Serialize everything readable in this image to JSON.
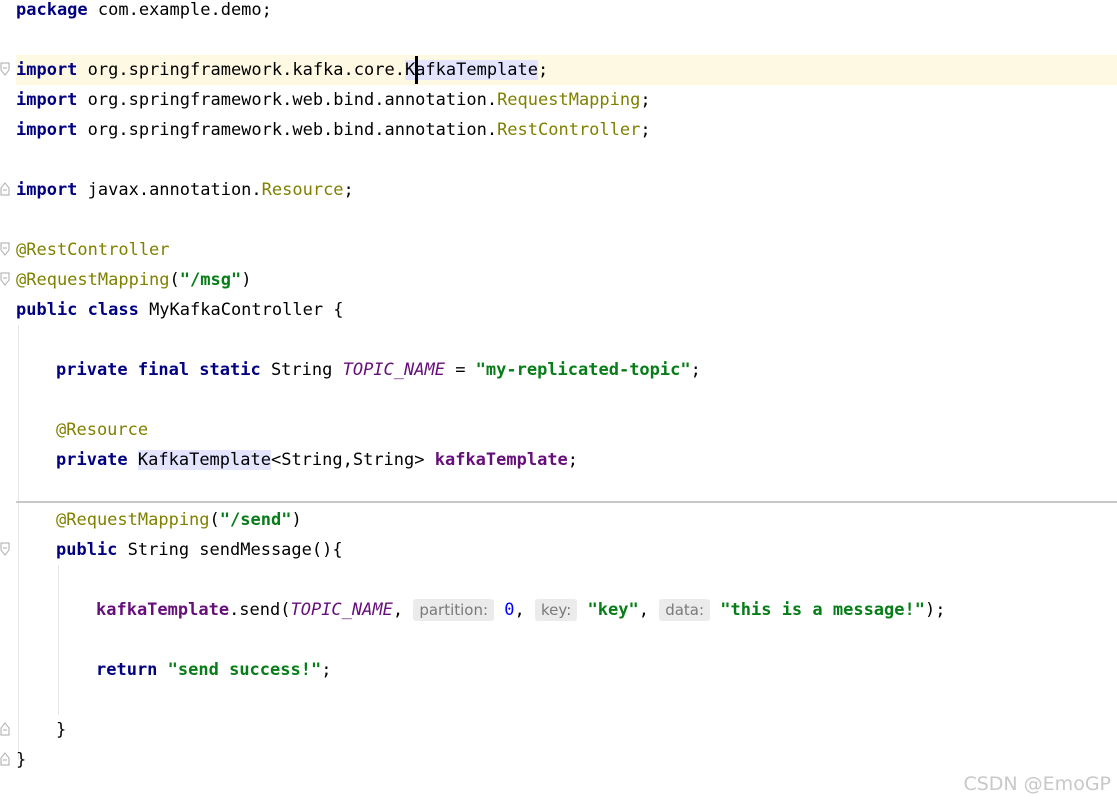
{
  "code": {
    "l1": {
      "kw": "package",
      "rest": " com.example.demo;"
    },
    "l3": {
      "kw": "import",
      "pkg": " org.springframework.kafka.core.",
      "cls_a": "K",
      "cls_b": "afkaTemplate",
      "end": ";"
    },
    "l4": {
      "kw": "import",
      "pkg": " org.springframework.web.bind.annotation.",
      "cls": "RequestMapping",
      "end": ";"
    },
    "l5": {
      "kw": "import",
      "pkg": " org.springframework.web.bind.annotation.",
      "cls": "RestController",
      "end": ";"
    },
    "l7": {
      "kw": "import",
      "pkg": " javax.annotation.",
      "cls": "Resource",
      "end": ";"
    },
    "l9": {
      "ann": "@RestController"
    },
    "l10": {
      "ann": "@RequestMapping",
      "open": "(",
      "str": "\"/msg\"",
      "close": ")"
    },
    "l11": {
      "kw": "public class",
      "rest": " MyKafkaController {"
    },
    "l13": {
      "kw": "private final static",
      "type": " String ",
      "const": "TOPIC_NAME",
      "eq": " = ",
      "str": "\"my-replicated-topic\"",
      "end": ";"
    },
    "l15": {
      "ann": "@Resource"
    },
    "l16": {
      "kw": "private",
      "sp": " ",
      "type": "KafkaTemplate",
      "generic": "<String,String> ",
      "field": "kafkaTemplate",
      "end": ";"
    },
    "l18": {
      "ann": "@RequestMapping",
      "open": "(",
      "str": "\"/send\"",
      "close": ")"
    },
    "l19": {
      "kw": "public",
      "rest": " String sendMessage(){"
    },
    "l21": {
      "field": "kafkaTemplate",
      "call": ".send(",
      "const": "TOPIC_NAME",
      "comma": ", ",
      "hint_partition": "partition:",
      "num": "0",
      "comma2": ", ",
      "hint_key": "key:",
      "str_key": "\"key\"",
      "comma3": ", ",
      "hint_data": "data:",
      "str_data": "\"this is a message!\"",
      "end": ");"
    },
    "l23": {
      "kw": "return",
      "sp": " ",
      "str": "\"send success!\"",
      "end": ";"
    },
    "l25": {
      "text": "}"
    },
    "l26": {
      "text": "}"
    }
  },
  "watermark": "CSDN @EmoGP"
}
